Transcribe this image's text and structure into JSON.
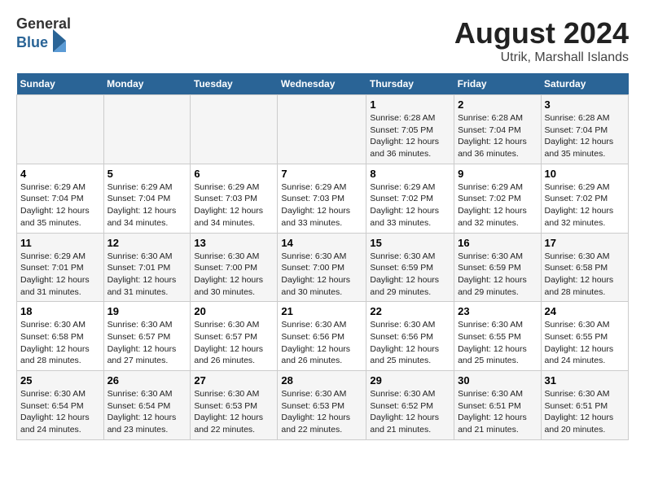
{
  "header": {
    "logo": {
      "general": "General",
      "blue": "Blue"
    },
    "title": "August 2024",
    "subtitle": "Utrik, Marshall Islands"
  },
  "weekdays": [
    "Sunday",
    "Monday",
    "Tuesday",
    "Wednesday",
    "Thursday",
    "Friday",
    "Saturday"
  ],
  "weeks": [
    [
      {
        "day": "",
        "info": ""
      },
      {
        "day": "",
        "info": ""
      },
      {
        "day": "",
        "info": ""
      },
      {
        "day": "",
        "info": ""
      },
      {
        "day": "1",
        "info": "Sunrise: 6:28 AM\nSunset: 7:05 PM\nDaylight: 12 hours\nand 36 minutes."
      },
      {
        "day": "2",
        "info": "Sunrise: 6:28 AM\nSunset: 7:04 PM\nDaylight: 12 hours\nand 36 minutes."
      },
      {
        "day": "3",
        "info": "Sunrise: 6:28 AM\nSunset: 7:04 PM\nDaylight: 12 hours\nand 35 minutes."
      }
    ],
    [
      {
        "day": "4",
        "info": "Sunrise: 6:29 AM\nSunset: 7:04 PM\nDaylight: 12 hours\nand 35 minutes."
      },
      {
        "day": "5",
        "info": "Sunrise: 6:29 AM\nSunset: 7:04 PM\nDaylight: 12 hours\nand 34 minutes."
      },
      {
        "day": "6",
        "info": "Sunrise: 6:29 AM\nSunset: 7:03 PM\nDaylight: 12 hours\nand 34 minutes."
      },
      {
        "day": "7",
        "info": "Sunrise: 6:29 AM\nSunset: 7:03 PM\nDaylight: 12 hours\nand 33 minutes."
      },
      {
        "day": "8",
        "info": "Sunrise: 6:29 AM\nSunset: 7:02 PM\nDaylight: 12 hours\nand 33 minutes."
      },
      {
        "day": "9",
        "info": "Sunrise: 6:29 AM\nSunset: 7:02 PM\nDaylight: 12 hours\nand 32 minutes."
      },
      {
        "day": "10",
        "info": "Sunrise: 6:29 AM\nSunset: 7:02 PM\nDaylight: 12 hours\nand 32 minutes."
      }
    ],
    [
      {
        "day": "11",
        "info": "Sunrise: 6:29 AM\nSunset: 7:01 PM\nDaylight: 12 hours\nand 31 minutes."
      },
      {
        "day": "12",
        "info": "Sunrise: 6:30 AM\nSunset: 7:01 PM\nDaylight: 12 hours\nand 31 minutes."
      },
      {
        "day": "13",
        "info": "Sunrise: 6:30 AM\nSunset: 7:00 PM\nDaylight: 12 hours\nand 30 minutes."
      },
      {
        "day": "14",
        "info": "Sunrise: 6:30 AM\nSunset: 7:00 PM\nDaylight: 12 hours\nand 30 minutes."
      },
      {
        "day": "15",
        "info": "Sunrise: 6:30 AM\nSunset: 6:59 PM\nDaylight: 12 hours\nand 29 minutes."
      },
      {
        "day": "16",
        "info": "Sunrise: 6:30 AM\nSunset: 6:59 PM\nDaylight: 12 hours\nand 29 minutes."
      },
      {
        "day": "17",
        "info": "Sunrise: 6:30 AM\nSunset: 6:58 PM\nDaylight: 12 hours\nand 28 minutes."
      }
    ],
    [
      {
        "day": "18",
        "info": "Sunrise: 6:30 AM\nSunset: 6:58 PM\nDaylight: 12 hours\nand 28 minutes."
      },
      {
        "day": "19",
        "info": "Sunrise: 6:30 AM\nSunset: 6:57 PM\nDaylight: 12 hours\nand 27 minutes."
      },
      {
        "day": "20",
        "info": "Sunrise: 6:30 AM\nSunset: 6:57 PM\nDaylight: 12 hours\nand 26 minutes."
      },
      {
        "day": "21",
        "info": "Sunrise: 6:30 AM\nSunset: 6:56 PM\nDaylight: 12 hours\nand 26 minutes."
      },
      {
        "day": "22",
        "info": "Sunrise: 6:30 AM\nSunset: 6:56 PM\nDaylight: 12 hours\nand 25 minutes."
      },
      {
        "day": "23",
        "info": "Sunrise: 6:30 AM\nSunset: 6:55 PM\nDaylight: 12 hours\nand 25 minutes."
      },
      {
        "day": "24",
        "info": "Sunrise: 6:30 AM\nSunset: 6:55 PM\nDaylight: 12 hours\nand 24 minutes."
      }
    ],
    [
      {
        "day": "25",
        "info": "Sunrise: 6:30 AM\nSunset: 6:54 PM\nDaylight: 12 hours\nand 24 minutes."
      },
      {
        "day": "26",
        "info": "Sunrise: 6:30 AM\nSunset: 6:54 PM\nDaylight: 12 hours\nand 23 minutes."
      },
      {
        "day": "27",
        "info": "Sunrise: 6:30 AM\nSunset: 6:53 PM\nDaylight: 12 hours\nand 22 minutes."
      },
      {
        "day": "28",
        "info": "Sunrise: 6:30 AM\nSunset: 6:53 PM\nDaylight: 12 hours\nand 22 minutes."
      },
      {
        "day": "29",
        "info": "Sunrise: 6:30 AM\nSunset: 6:52 PM\nDaylight: 12 hours\nand 21 minutes."
      },
      {
        "day": "30",
        "info": "Sunrise: 6:30 AM\nSunset: 6:51 PM\nDaylight: 12 hours\nand 21 minutes."
      },
      {
        "day": "31",
        "info": "Sunrise: 6:30 AM\nSunset: 6:51 PM\nDaylight: 12 hours\nand 20 minutes."
      }
    ]
  ]
}
